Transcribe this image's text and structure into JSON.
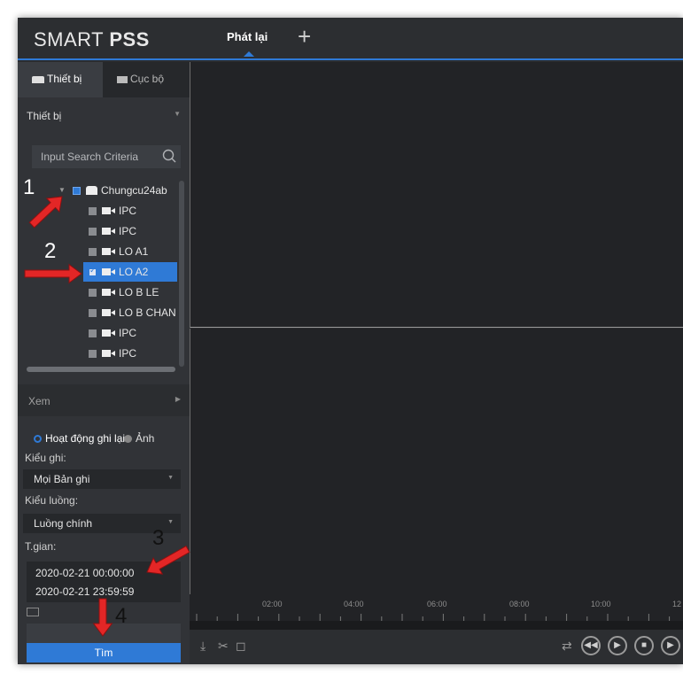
{
  "app": {
    "title_light": "SMART ",
    "title_bold": "PSS",
    "tab_playback": "Phát lại",
    "add_tab": "+"
  },
  "left_panel": {
    "tabs": [
      {
        "label": "Thiết bị",
        "icon": "device-icon",
        "active": true
      },
      {
        "label": "Cục bộ",
        "icon": "monitor-icon",
        "active": false
      }
    ],
    "device_dropdown": "Thiết bị",
    "search_placeholder": "Input Search Criteria",
    "tree": {
      "root": {
        "label": "Chungcu24ab",
        "checked": "partial"
      },
      "children": [
        {
          "label": "IPC",
          "checked": false
        },
        {
          "label": "IPC",
          "checked": false
        },
        {
          "label": "LO A1",
          "checked": false
        },
        {
          "label": "LO A2",
          "checked": true
        },
        {
          "label": "LO B LE",
          "checked": false
        },
        {
          "label": "LO B CHAN",
          "checked": false
        },
        {
          "label": "IPC",
          "checked": false
        },
        {
          "label": "IPC",
          "checked": false
        }
      ]
    },
    "view_section": "Xem",
    "record_type_options": [
      {
        "label": "Hoạt động ghi lại",
        "selected": true
      },
      {
        "label": "Ảnh",
        "selected": false
      }
    ],
    "record_kind_label": "Kiểu ghi:",
    "record_kind_value": "Mọi Bản ghi",
    "stream_label": "Kiểu luồng:",
    "stream_value": "Luồng chính",
    "time_label": "T.gian:",
    "time_start": "2020-02-21 00:00:00",
    "time_end": "2020-02-21 23:59:59",
    "search_button": "Tìm"
  },
  "timeline": {
    "ticks": [
      "02:00",
      "04:00",
      "06:00",
      "08:00",
      "10:00",
      "12"
    ]
  },
  "annotations": {
    "n1": "1",
    "n2": "2",
    "n3": "3",
    "n4": "4",
    "arrow_color": "#e32626"
  },
  "colors": {
    "accent": "#2f7ad6",
    "background": "#2b2d30"
  }
}
